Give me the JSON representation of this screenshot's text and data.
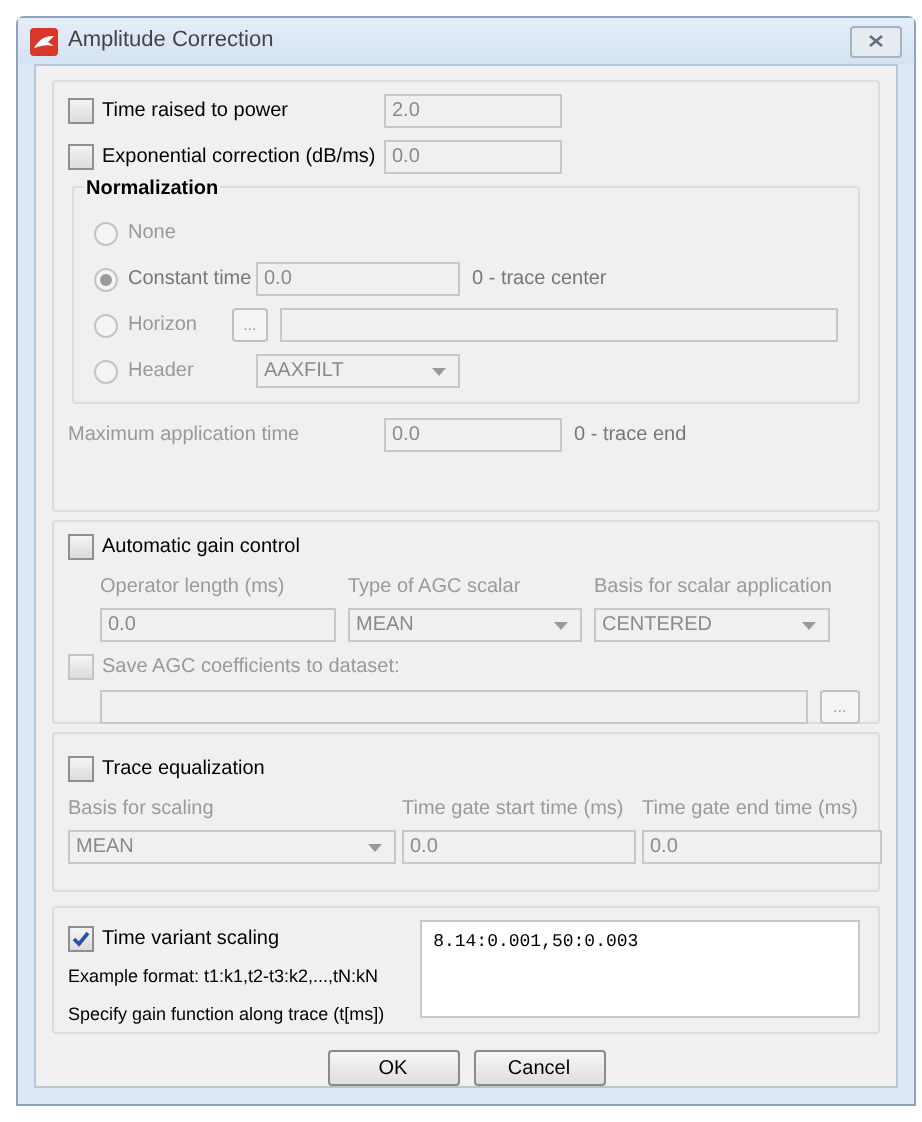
{
  "window": {
    "title": "Amplitude Correction"
  },
  "time_power": {
    "label": "Time raised to power",
    "checked": false,
    "value": "2.0"
  },
  "exp_correction": {
    "label": "Exponential correction (dB/ms)",
    "checked": false,
    "value": "0.0"
  },
  "normalization": {
    "title": "Normalization",
    "options": [
      {
        "kind": "plain",
        "label": "None",
        "selected": false
      },
      {
        "kind": "field",
        "label": "Constant time",
        "selected": true,
        "value": "0.0",
        "note": "0 - trace center"
      },
      {
        "kind": "browse",
        "label": "Horizon",
        "selected": false,
        "button": "..."
      },
      {
        "kind": "dropdown",
        "label": "Header",
        "selected": false,
        "value": "AAXFILT"
      }
    ]
  },
  "max_time": {
    "label": "Maximum application time",
    "value": "0.0",
    "note": "0 - trace end"
  },
  "agc": {
    "label": "Automatic gain control",
    "checked": false,
    "columns": [
      {
        "kind": "field",
        "label": "Operator length (ms)",
        "value": "0.0"
      },
      {
        "kind": "dropdown",
        "label": "Type of AGC scalar",
        "value": "MEAN"
      },
      {
        "kind": "dropdown",
        "label": "Basis for scalar application",
        "value": "CENTERED"
      }
    ],
    "save": {
      "label": "Save AGC coefficients to dataset:",
      "checked": false,
      "button": "..."
    }
  },
  "trace_eq": {
    "label": "Trace equalization",
    "checked": false,
    "columns": [
      {
        "kind": "dropdown",
        "label": "Basis for scaling",
        "value": "MEAN"
      },
      {
        "kind": "field",
        "label": "Time gate start time (ms)",
        "value": "0.0"
      },
      {
        "kind": "field",
        "label": "Time gate end time (ms)",
        "value": "0.0"
      }
    ]
  },
  "tvs": {
    "label": "Time variant scaling",
    "checked": true,
    "example": "Example format: t1:k1,t2-t3:k2,...,tN:kN",
    "hint": "Specify gain function along trace (t[ms])",
    "value": "8.14:0.001,50:0.003"
  },
  "buttons": [
    {
      "label": "OK"
    },
    {
      "label": "Cancel"
    }
  ]
}
